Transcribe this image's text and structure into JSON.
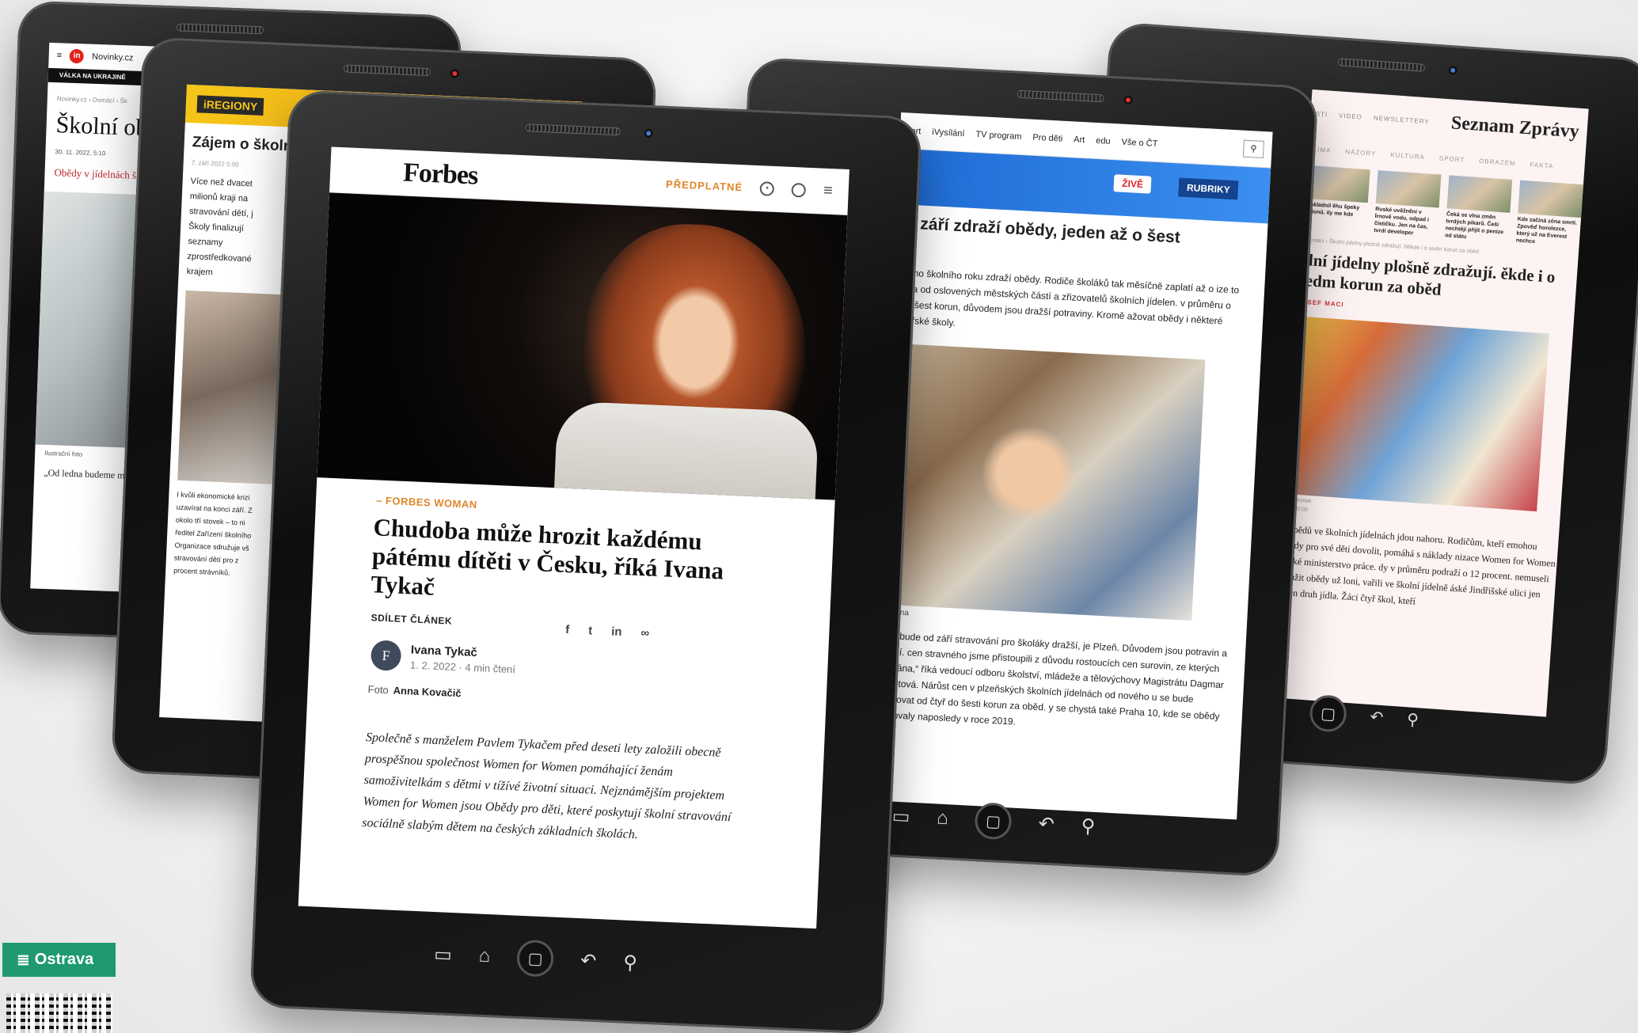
{
  "novinky": {
    "site": "Novinky.cz",
    "section_band": "VÁLKA NA UKRAJINĚ",
    "breadcrumb": "Novinky.cz › Domácí › Šk",
    "title": "Školní ob",
    "meta": "30. 11. 2022, 5:10",
    "lead": "Obědy v jídelnách š zvyšovala jejich cen opět zdražit. V někt",
    "caption": "Ilustrační foto",
    "body": "„Od ledna budeme m dražé potraviny. Zati uzávěrka, ale předpoklá ředitelka českobudě"
  },
  "iregiony": {
    "logo": "iREGIONY",
    "title": "Zájem o školní kvůli ekonom",
    "date": "7. září 2022 5:00",
    "lead": "Více než dvacet milionů kraji na stravování dětí, j Školy finalizují seznamy zprostředkované krajem",
    "body": "I kvůli ekonomické krizi uzavírat na konci září. Z okolo tří stovek – to ni ředitel Zařízení školního Organizace sdružuje vš stravování dětí pro z procent strávníků."
  },
  "forbes": {
    "logo": "Forbes",
    "subscribe": "PŘEDPLATNÉ",
    "kicker": "– FORBES WOMAN",
    "title": "Chudoba může hrozit každému pátému dítěti v Česku, říká Ivana Tykač",
    "share_label": "SDÍLET ČLÁNEK",
    "author_initial": "F",
    "author": "Ivana Tykač",
    "date": "1. 2. 2022 · 4 min čtení",
    "photo_label": "Foto",
    "photo_credit": "Anna Kovačič",
    "lead": "Společně s manželem Pavlem Tykačem před deseti lety založili obecně prospěšnou společnost Women for Women pomáhající ženám samoživitelkám s dětmi v tížívé životní situaci. Nejznámějším projektem Women for Women jsou Obědy pro děti, které poskytují školní stravování sociálně slabým dětem na českých základních školách."
  },
  "ct24": {
    "nav": [
      "Sport",
      "iVysílání",
      "TV program",
      "Pro děti",
      "Art",
      "edu",
      "Vše o ČT"
    ],
    "live": "ŽIVĚ",
    "rubrics": "RUBRIKY",
    "title": "od září zdraží obědy, jeden až o šest",
    "lead": "nového školního roku zdraží obědy. Rodiče školáků tak měsíčně zaplatí až o ize to zjistila od oslovených městských částí a zřizovatelů školních jídelen. v průměru o tři až šest korun, důvodem jsou dražší potraviny. Kromě ažovat obědy i některé mateřské školy.",
    "caption": "av Ožena",
    "body": "t, kde bude od září stravování pro školáky dražší, je Plzeň. Důvodem jsou potravin a energií. cen stravného jsme přistoupili z důvodu rostoucích cen surovin, ze kterých je vována,“ říká vedoucí odboru školství, mládeže a tělovýchovy Magistrátu Dagmar Škrlantová. Nárůst cen v plzeňských školních jídelnách od nového u se bude pohybovat od čtyř do šesti korun za oběd. y se chystá také Praha 10, kde se obědy zdražovaly naposledy v roce 2019."
  },
  "seznam": {
    "top_links": [
      "ASTI",
      "VIDEO",
      "NEWSLETTERY"
    ],
    "logo": "Seznam Zprávy",
    "categories": [
      "KLIMA",
      "NÁZORY",
      "KULTURA",
      "SPORT",
      "OBRAZEM",
      "FAKTA"
    ],
    "thumbs": [
      "vyskladnil ěhu špeky milionů. ily me kde",
      "Ruské uvěžnění v Írnově vodu, odpad i čističku. Jen na čas, tvrdí developer",
      "Čeká se vlna změn tvrdých pikarů. Češi nechtějí přijít o peníze od státu",
      "Kde začíná zóna smrti. Zpověď horolezce, který už na Everest nechce"
    ],
    "breadcrumb": "› Domácí › Školní jídelny plošně zdražují. Někde i o sedm korun za oběd",
    "title": "olní jídelny plošně zdražují. ěkde i o sedm korun za oběd",
    "author": "JOSEF MACI",
    "caption": "ový snímek",
    "date": "2022 5:00",
    "body": "y obědů ve školních jídelnách jdou nahoru. Rodičům, kteří emohou obědy pro své děti dovolit, pomáhá s náklady nizace Women for Women a také ministerstvo práce. dy v průměru podraží o 12 procent. nemuseli zdražit obědy už loni, vařili ve školní jídelně áské Jindřišské ulici jen jeden druh jídla. Žáci čtyř škol, kteří"
  },
  "badge": {
    "label": "Ostrava"
  },
  "icons": [
    "search-icon",
    "user-icon",
    "menu-icon",
    "home-icon",
    "back-icon",
    "window-icon",
    "facebook-icon",
    "twitter-icon",
    "linkedin-icon",
    "link-icon"
  ]
}
